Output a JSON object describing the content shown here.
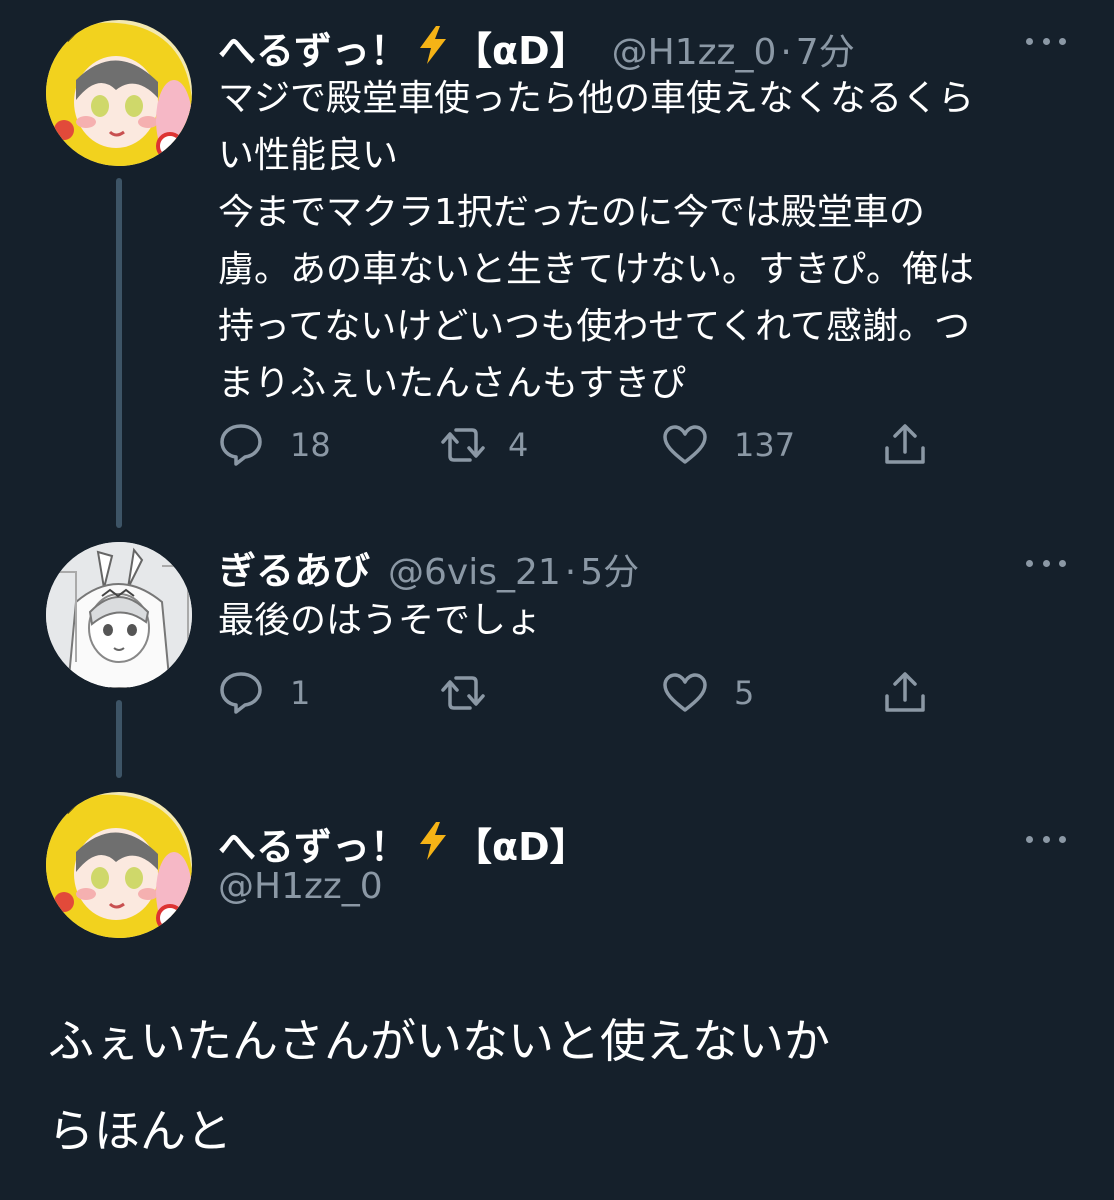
{
  "colors": {
    "background": "#15202b",
    "text_primary": "#ffffff",
    "text_secondary": "#8b98a5",
    "thread_line": "#3d5466",
    "bolt": "#f5b316"
  },
  "tweets": [
    {
      "display_name": "へるずっ！",
      "emoji": "lightning-icon",
      "name_tag": "【αD】",
      "handle": "@H1zz_0",
      "separator": "·",
      "time": "7分",
      "text": "マジで殿堂車使ったら他の車使えなくなるくら\nい性能良い\n今までマクラ1択だったのに今では殿堂車の\n虜。あの車ないと生きてけない。すきぴ。俺は\n持ってないけどいつも使わせてくれて感謝。つ\nまりふぇいたんさんもすきぴ",
      "reply_count": "18",
      "retweet_count": "4",
      "like_count": "137"
    },
    {
      "display_name": "ぎるあび",
      "handle": "@6vis_21",
      "separator": "·",
      "time": "5分",
      "text": "最後のはうそでしょ",
      "reply_count": "1",
      "retweet_count": "",
      "like_count": "5"
    }
  ],
  "main_tweet": {
    "display_name": "へるずっ！",
    "emoji": "lightning-icon",
    "name_tag": "【αD】",
    "handle": "@H1zz_0",
    "text": "ふぇいたんさんがいないと使えないか\nらほんと"
  }
}
